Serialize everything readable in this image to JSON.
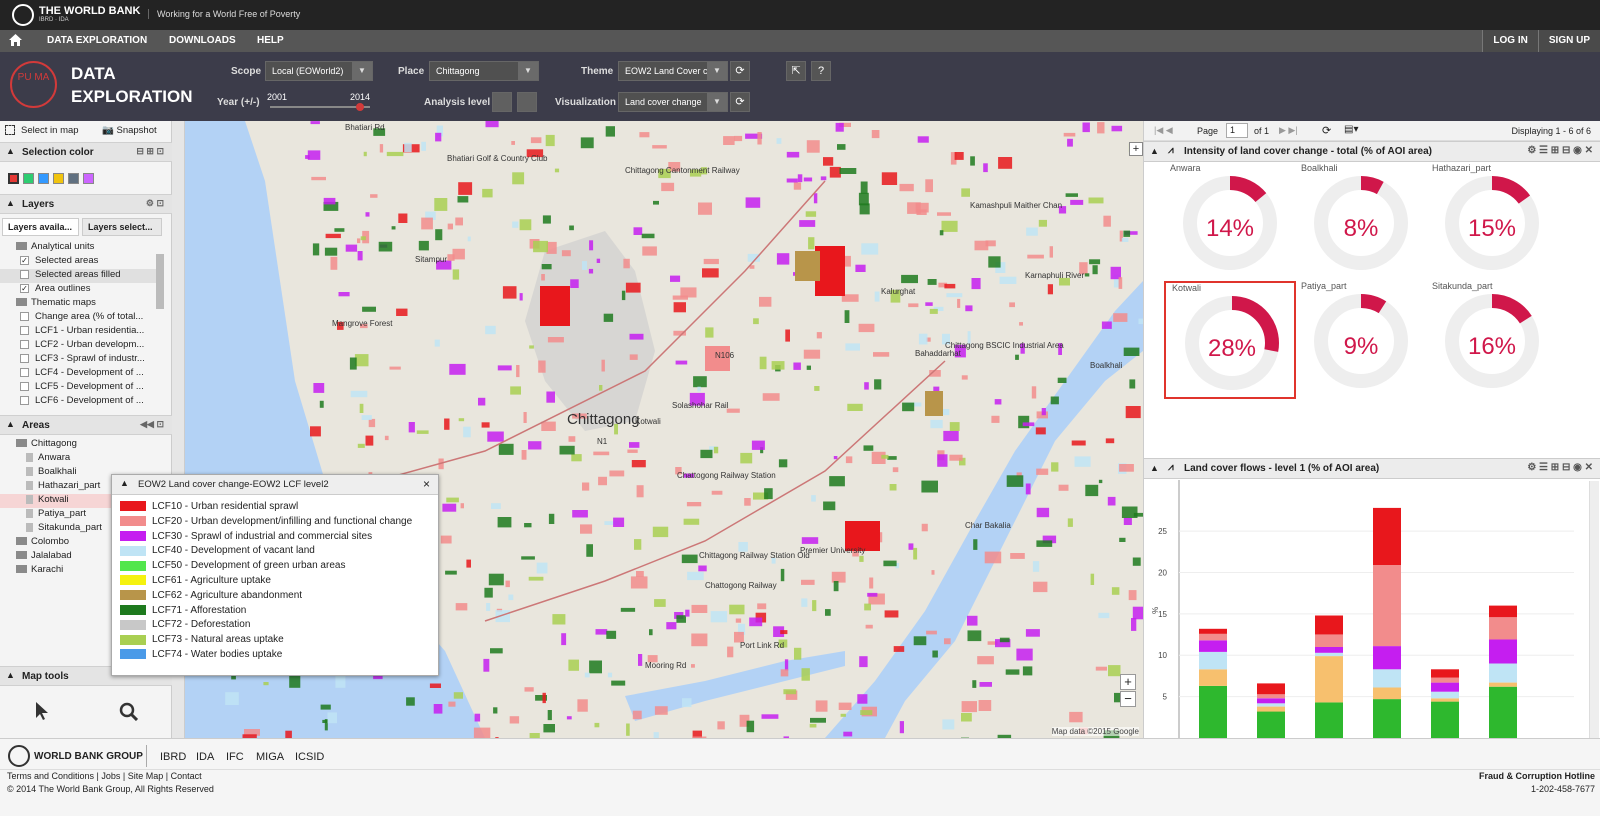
{
  "topbar": {
    "org_name": "THE WORLD BANK",
    "org_sub": "IBRD · IDA",
    "tagline": "Working for a World Free of Poverty"
  },
  "nav": {
    "items": [
      "DATA EXPLORATION",
      "DOWNLOADS",
      "HELP"
    ],
    "login": "LOG IN",
    "signup": "SIGN UP"
  },
  "header": {
    "logo_text": "PU MA",
    "title_line1": "DATA",
    "title_line2": "EXPLORATION",
    "scope_label": "Scope",
    "scope_value": "Local (EOWorld2)",
    "place_label": "Place",
    "place_value": "Chittagong",
    "theme_label": "Theme",
    "theme_value": "EOW2 Land Cover c",
    "year_label": "Year (+/-)",
    "year_start": "2001",
    "year_end": "2014",
    "analysis_label": "Analysis level",
    "viz_label": "Visualization",
    "viz_value": "Land cover change"
  },
  "left": {
    "select_in_map": "Select in map",
    "snapshot": "Snapshot",
    "selection_color": "Selection color",
    "selection_colors": [
      "#e53935",
      "#2ecc71",
      "#3399ff",
      "#f1c40f",
      "#607080",
      "#cc66ff"
    ],
    "layers_title": "Layers",
    "tab_available": "Layers availa...",
    "tab_selected": "Layers select...",
    "layer_rows": [
      {
        "label": "Analytical units",
        "kind": "folder"
      },
      {
        "label": "Selected areas",
        "kind": "checked"
      },
      {
        "label": "Selected areas filled",
        "kind": "unchecked"
      },
      {
        "label": "Area outlines",
        "kind": "checked"
      },
      {
        "label": "Thematic maps",
        "kind": "folder"
      },
      {
        "label": "Change area (% of total...",
        "kind": "unchecked"
      },
      {
        "label": "LCF1 - Urban residentia...",
        "kind": "unchecked"
      },
      {
        "label": "LCF2 - Urban developm...",
        "kind": "unchecked"
      },
      {
        "label": "LCF3 - Sprawl of industr...",
        "kind": "unchecked"
      },
      {
        "label": "LCF4 - Development of ...",
        "kind": "unchecked"
      },
      {
        "label": "LCF5 - Development of ...",
        "kind": "unchecked"
      },
      {
        "label": "LCF6 - Development of ...",
        "kind": "unchecked"
      }
    ],
    "areas_title": "Areas",
    "area_rows": [
      {
        "label": "Chittagong",
        "kind": "folder"
      },
      {
        "label": "Anwara",
        "kind": "leaf"
      },
      {
        "label": "Boalkhali",
        "kind": "leaf"
      },
      {
        "label": "Hathazari_part",
        "kind": "leaf"
      },
      {
        "label": "Kotwali",
        "kind": "selected"
      },
      {
        "label": "Patiya_part",
        "kind": "leaf"
      },
      {
        "label": "Sitakunda_part",
        "kind": "leaf"
      },
      {
        "label": "Colombo",
        "kind": "folder-collapsed"
      },
      {
        "label": "Jalalabad",
        "kind": "folder-collapsed"
      },
      {
        "label": "Karachi",
        "kind": "folder-collapsed"
      }
    ],
    "map_tools_title": "Map tools"
  },
  "map": {
    "labels": [
      "Bhatiari Rd",
      "Bhatiari Golf & Country Club",
      "Chittagong Cantonment Railway",
      "Sitampur",
      "Mangrove Forest",
      "Kalurghat",
      "Chittagong",
      "Kotwali",
      "Solashohar Rail",
      "Chattogong Railway Station",
      "Chittagong Railway Station Old",
      "Premier University",
      "Chattogong Railway",
      "Bahaddarhat",
      "Chittagong BSCIC Industrial Area",
      "Char Bakalia",
      "Karnaphuli River",
      "Boalkhali",
      "Kamashpuli Maither Chan",
      "Port Link Rd",
      "Mooring Rd",
      "N106",
      "N1"
    ],
    "attribution": "Map data ©2015 Google"
  },
  "legend": {
    "title": "EOW2 Land cover change-EOW2 LCF level2",
    "items": [
      {
        "label": "LCF10 - Urban residential sprawl",
        "color": "#e8171c"
      },
      {
        "label": "LCF20 - Urban development/infilling and functional change",
        "color": "#f28c8c"
      },
      {
        "label": "LCF30 - Sprawl of industrial and commercial sites",
        "color": "#c51ef0"
      },
      {
        "label": "LCF40 - Development of vacant land",
        "color": "#bfe4f5"
      },
      {
        "label": "LCF50 - Development of green urban areas",
        "color": "#52e64c"
      },
      {
        "label": "LCF61 - Agriculture uptake",
        "color": "#f5f20f"
      },
      {
        "label": "LCF62 - Agriculture abandonment",
        "color": "#b8954a"
      },
      {
        "label": "LCF71 - Afforestation",
        "color": "#1e7a1e"
      },
      {
        "label": "LCF72 - Deforestation",
        "color": "#c8c8c8"
      },
      {
        "label": "LCF73 - Natural areas uptake",
        "color": "#a9cf52"
      },
      {
        "label": "LCF74 - Water bodies uptake",
        "color": "#4a9ae8"
      }
    ]
  },
  "right": {
    "page_label": "Page",
    "page_value": "1",
    "of_label": "of 1",
    "displaying": "Displaying 1 - 6 of 6",
    "widget1_title": "Intensity of land cover change - total (% of AOI area)",
    "widget2_title": "Land cover flows - level 1 (% of AOI area)"
  },
  "chart_data": [
    {
      "type": "pie",
      "title": "Intensity of land cover change - total (% of AOI area)",
      "categories": [
        "Anwara",
        "Boalkhali",
        "Hathazari_part",
        "Kotwali",
        "Patiya_part",
        "Sitakunda_part"
      ],
      "values": [
        14,
        8,
        15,
        28,
        9,
        16
      ],
      "labels": [
        "14%",
        "8%",
        "15%",
        "28%",
        "9%",
        "16%"
      ],
      "selected": "Kotwali",
      "color": "#d0174a"
    },
    {
      "type": "bar",
      "stacked": true,
      "title": "Land cover flows - level 1 (% of AOI area)",
      "ylabel": "%",
      "yticks": [
        "5",
        "10",
        "15",
        "20",
        "25"
      ],
      "ylim": [
        0,
        29
      ],
      "categories": [
        "Anwara",
        "Boalkhali",
        "Hathazari_part",
        "Kotwali",
        "Patiya_part",
        "Sitakunda_part"
      ],
      "series": [
        {
          "color": "#2eb82e",
          "values": [
            6.3,
            3.2,
            4.3,
            4.7,
            4.4,
            6.2
          ]
        },
        {
          "color": "#f7c06e",
          "values": [
            2,
            0.6,
            5.6,
            1.4,
            0.4,
            0.5
          ]
        },
        {
          "color": "#bfe4f5",
          "values": [
            2.1,
            0.4,
            0.4,
            2.2,
            0.8,
            2.3
          ]
        },
        {
          "color": "#c51ef0",
          "values": [
            1.4,
            0.6,
            0.7,
            2.8,
            1.1,
            2.9
          ]
        },
        {
          "color": "#f28c8c",
          "values": [
            0.8,
            0.5,
            1.5,
            9.8,
            0.6,
            2.7
          ]
        },
        {
          "color": "#e8171c",
          "values": [
            0.6,
            1.3,
            2.3,
            6.9,
            1,
            1.4
          ]
        }
      ]
    }
  ],
  "footer": {
    "brand": "WORLD BANK GROUP",
    "links": [
      "IBRD",
      "IDA",
      "IFC",
      "MIGA",
      "ICSID"
    ],
    "bottom_links": "Terms and Conditions | Jobs | Site Map | Contact",
    "copyright": "© 2014 The World Bank Group, All Rights Reserved",
    "hotline": "Fraud & Corruption Hotline",
    "phone": "1-202-458-7677"
  }
}
